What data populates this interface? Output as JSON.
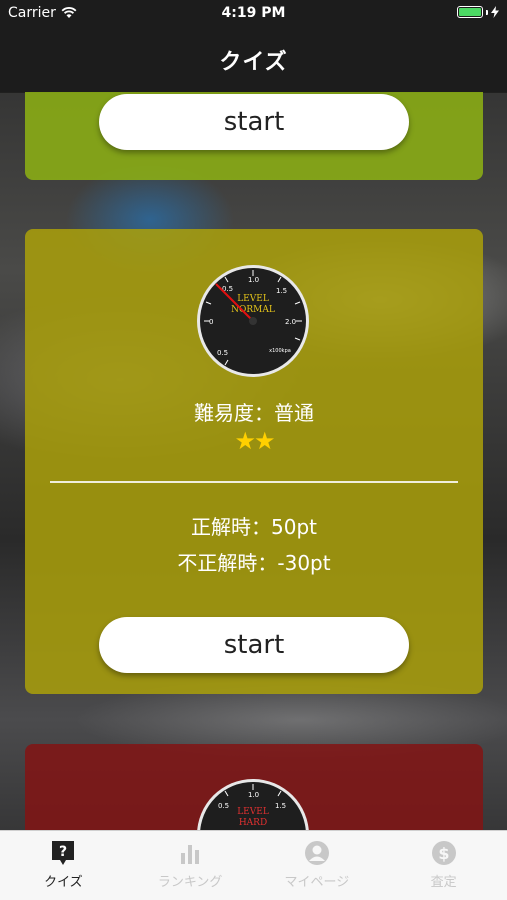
{
  "status": {
    "carrier": "Carrier",
    "time": "4:19 PM"
  },
  "nav": {
    "title": "クイズ"
  },
  "cards": {
    "green": {
      "start_label": "start"
    },
    "yellow": {
      "gauge": {
        "line1": "LEVEL",
        "line2": "NORMAL",
        "unit": "x100kpa",
        "ticks": [
          "0",
          "0.5",
          "1.0",
          "1.5",
          "2.0"
        ]
      },
      "difficulty_label": "難易度：普通",
      "stars": 2,
      "stars_text": "★★",
      "correct": "正解時：50pt",
      "incorrect": "不正解時：-30pt",
      "start_label": "start"
    },
    "red": {
      "gauge": {
        "line1": "LEVEL",
        "line2": "HARD",
        "ticks": [
          "0.5",
          "1.0",
          "1.5"
        ]
      }
    }
  },
  "tabbar": {
    "items": [
      {
        "label": "クイズ",
        "icon": "quiz-icon",
        "active": true
      },
      {
        "label": "ランキング",
        "icon": "ranking-icon",
        "active": false
      },
      {
        "label": "マイページ",
        "icon": "mypage-icon",
        "active": false
      },
      {
        "label": "査定",
        "icon": "assessment-icon",
        "active": false
      }
    ]
  },
  "colors": {
    "green_card": "#8caf14",
    "yellow_card": "#aaa00a",
    "red_card": "#821414",
    "star": "#ffd000"
  }
}
